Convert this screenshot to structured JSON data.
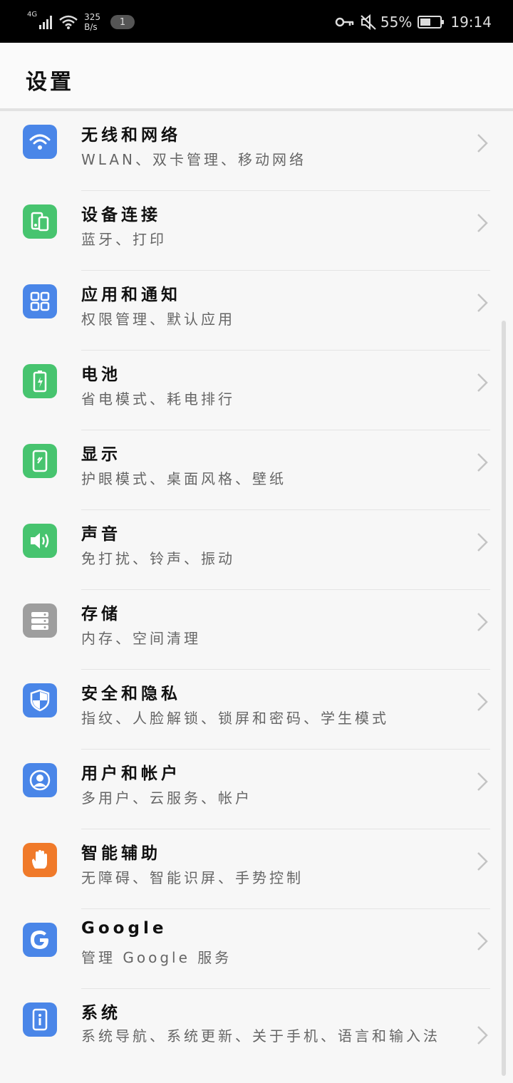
{
  "status_bar": {
    "network_type": "4G",
    "speed_value": "325",
    "speed_unit": "B/s",
    "notification_count": "1",
    "battery_percent": "55%",
    "battery_level": 0.55,
    "time": "19:14"
  },
  "header": {
    "title": "设置"
  },
  "settings": [
    {
      "title": "无线和网络",
      "subtitle": "WLAN、双卡管理、移动网络",
      "icon": "wifi-icon",
      "color": "#4a86e8"
    },
    {
      "title": "设备连接",
      "subtitle": "蓝牙、打印",
      "icon": "device-connect-icon",
      "color": "#47c46f"
    },
    {
      "title": "应用和通知",
      "subtitle": "权限管理、默认应用",
      "icon": "apps-icon",
      "color": "#4a86e8"
    },
    {
      "title": "电池",
      "subtitle": "省电模式、耗电排行",
      "icon": "battery-icon",
      "color": "#47c46f"
    },
    {
      "title": "显示",
      "subtitle": "护眼模式、桌面风格、壁纸",
      "icon": "display-icon",
      "color": "#47c46f"
    },
    {
      "title": "声音",
      "subtitle": "免打扰、铃声、振动",
      "icon": "sound-icon",
      "color": "#47c46f"
    },
    {
      "title": "存储",
      "subtitle": "内存、空间清理",
      "icon": "storage-icon",
      "color": "#9e9e9e"
    },
    {
      "title": "安全和隐私",
      "subtitle": "指纹、人脸解锁、锁屏和密码、学生模式",
      "icon": "shield-icon",
      "color": "#4a86e8"
    },
    {
      "title": "用户和帐户",
      "subtitle": "多用户、云服务、帐户",
      "icon": "user-icon",
      "color": "#4a86e8"
    },
    {
      "title": "智能辅助",
      "subtitle": "无障碍、智能识屏、手势控制",
      "icon": "hand-icon",
      "color": "#f07a2a"
    },
    {
      "title": "Google",
      "subtitle": "管理 Google 服务",
      "icon": "google-icon",
      "color": "#4a86e8"
    },
    {
      "title": "系统",
      "subtitle": "系统导航、系统更新、关于手机、语言和输入法",
      "icon": "system-info-icon",
      "color": "#4a86e8"
    }
  ]
}
